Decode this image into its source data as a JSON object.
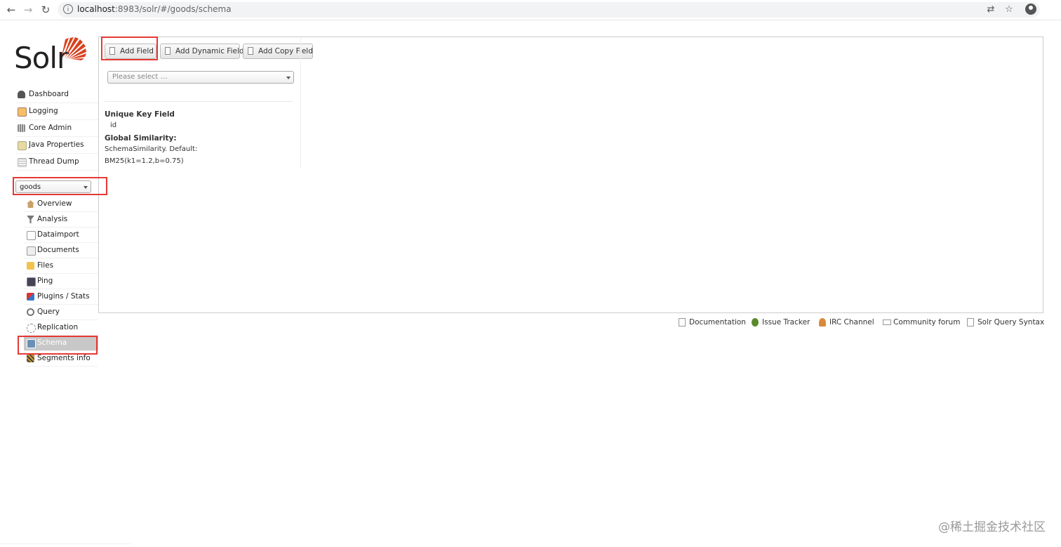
{
  "browser": {
    "url_host": "localhost",
    "url_rest": ":8983/solr/#/goods/schema"
  },
  "logo": {
    "text": "Solr"
  },
  "sidebar": {
    "items": [
      {
        "label": "Dashboard",
        "icon": "dashboard-icon"
      },
      {
        "label": "Logging",
        "icon": "logging-icon"
      },
      {
        "label": "Core Admin",
        "icon": "core-admin-icon"
      },
      {
        "label": "Java Properties",
        "icon": "java-icon"
      },
      {
        "label": "Thread Dump",
        "icon": "thread-dump-icon"
      }
    ],
    "core_selector": {
      "value": "goods"
    },
    "core_items": [
      {
        "label": "Overview",
        "icon": "home-icon"
      },
      {
        "label": "Analysis",
        "icon": "funnel-icon"
      },
      {
        "label": "Dataimport",
        "icon": "import-icon"
      },
      {
        "label": "Documents",
        "icon": "documents-icon"
      },
      {
        "label": "Files",
        "icon": "folder-icon"
      },
      {
        "label": "Ping",
        "icon": "ping-icon"
      },
      {
        "label": "Plugins / Stats",
        "icon": "plugins-icon"
      },
      {
        "label": "Query",
        "icon": "search-icon"
      },
      {
        "label": "Replication",
        "icon": "replication-icon"
      },
      {
        "label": "Schema",
        "icon": "schema-icon",
        "active": true
      },
      {
        "label": "Segments info",
        "icon": "segments-icon"
      }
    ]
  },
  "main": {
    "buttons": {
      "add_field": "Add Field",
      "add_dynamic_field": "Add Dynamic Field",
      "add_copy_field": "Add Copy Field"
    },
    "field_select": {
      "placeholder": "Please select …"
    },
    "unique_key": {
      "label": "Unique Key Field",
      "value": "id"
    },
    "similarity": {
      "label": "Global Similarity:",
      "line1": "SchemaSimilarity. Default:",
      "line2": "BM25(k1=1.2,b=0.75)"
    }
  },
  "footer": {
    "links": [
      "Documentation",
      "Issue Tracker",
      "IRC Channel",
      "Community forum",
      "Solr Query Syntax"
    ]
  },
  "watermark": "@稀土掘金技术社区",
  "colors": {
    "highlight": "#e53935",
    "logo_sun": "#d9411e",
    "active_menu_bg": "#c8c8c8"
  }
}
